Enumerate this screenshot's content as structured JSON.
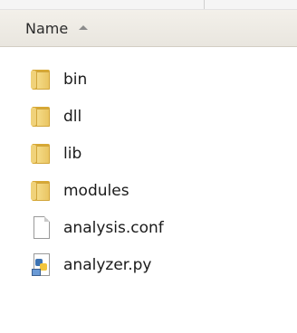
{
  "header": {
    "name_label": "Name",
    "sort": "ascending",
    "sort_icon": "sort-up-icon"
  },
  "files": [
    {
      "name": "bin",
      "type": "folder",
      "icon": "folder-icon"
    },
    {
      "name": "dll",
      "type": "folder",
      "icon": "folder-icon"
    },
    {
      "name": "lib",
      "type": "folder",
      "icon": "folder-icon"
    },
    {
      "name": "modules",
      "type": "folder",
      "icon": "folder-icon"
    },
    {
      "name": "analysis.conf",
      "type": "file",
      "icon": "file-icon"
    },
    {
      "name": "analyzer.py",
      "type": "python",
      "icon": "python-file-icon"
    }
  ],
  "colors": {
    "header_bg": "#ece9e2",
    "folder": "#e9c460",
    "text": "#1a1a1a"
  }
}
